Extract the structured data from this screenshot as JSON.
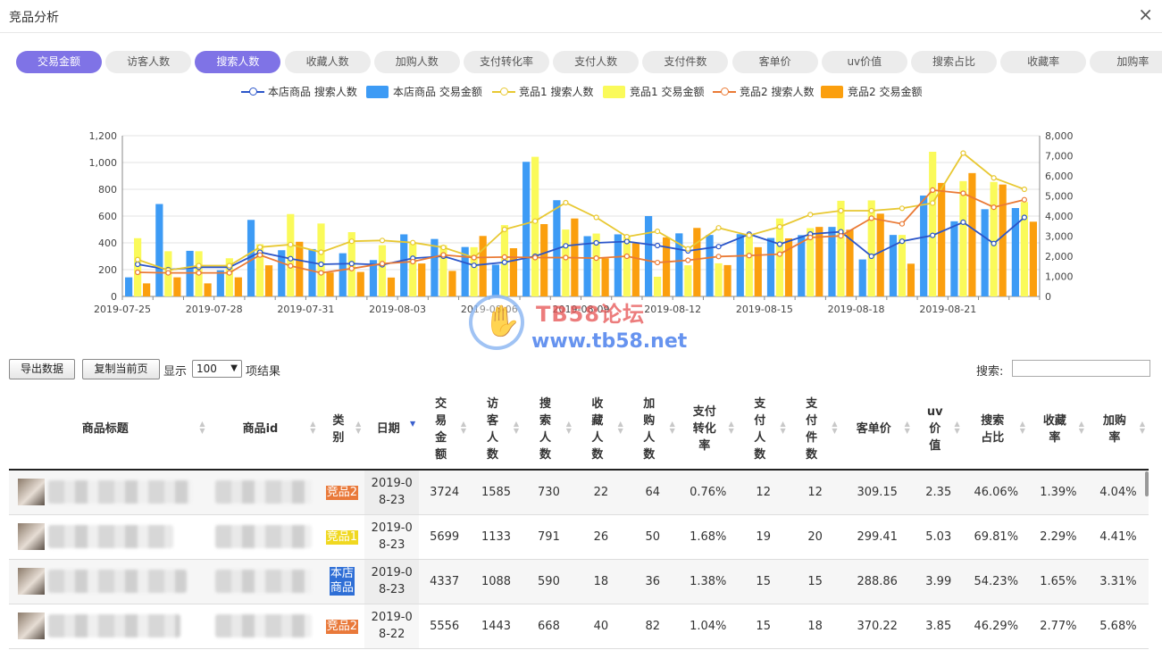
{
  "window": {
    "title": "竞品分析",
    "close_icon": "×"
  },
  "metric_tabs": [
    {
      "label": "交易金额",
      "active": true
    },
    {
      "label": "访客人数",
      "active": false
    },
    {
      "label": "搜索人数",
      "active": true
    },
    {
      "label": "收藏人数",
      "active": false
    },
    {
      "label": "加购人数",
      "active": false
    },
    {
      "label": "支付转化率",
      "active": false
    },
    {
      "label": "支付人数",
      "active": false
    },
    {
      "label": "支付件数",
      "active": false
    },
    {
      "label": "客单价",
      "active": false
    },
    {
      "label": "uv价值",
      "active": false
    },
    {
      "label": "搜索占比",
      "active": false
    },
    {
      "label": "收藏率",
      "active": false
    },
    {
      "label": "加购率",
      "active": false
    }
  ],
  "legend": [
    {
      "label": "本店商品 搜索人数",
      "kind": "line",
      "color": "#2b55c9"
    },
    {
      "label": "本店商品 交易金额",
      "kind": "bar",
      "color": "#3d9bf5"
    },
    {
      "label": "竞品1 搜索人数",
      "kind": "line",
      "color": "#e8c832"
    },
    {
      "label": "竞品1 交易金额",
      "kind": "bar",
      "color": "#fafa5a"
    },
    {
      "label": "竞品2 搜索人数",
      "kind": "line",
      "color": "#ea7a35"
    },
    {
      "label": "竞品2 交易金额",
      "kind": "bar",
      "color": "#fb9f0e"
    }
  ],
  "chart_data": {
    "type": "bar",
    "x": [
      "2019-07-25",
      "2019-07-26",
      "2019-07-27",
      "2019-07-28",
      "2019-07-29",
      "2019-07-30",
      "2019-07-31",
      "2019-08-01",
      "2019-08-02",
      "2019-08-03",
      "2019-08-04",
      "2019-08-05",
      "2019-08-06",
      "2019-08-07",
      "2019-08-08",
      "2019-08-09",
      "2019-08-10",
      "2019-08-11",
      "2019-08-12",
      "2019-08-13",
      "2019-08-14",
      "2019-08-15",
      "2019-08-16",
      "2019-08-17",
      "2019-08-18",
      "2019-08-19",
      "2019-08-20",
      "2019-08-21",
      "2019-08-22",
      "2019-08-23"
    ],
    "x_tick_labels": [
      "2019-07-25",
      "2019-07-28",
      "2019-07-31",
      "2019-08-03",
      "2019-08-06",
      "2019-08-09",
      "2019-08-12",
      "2019-08-15",
      "2019-08-18",
      "2019-08-21"
    ],
    "y_left": {
      "min": 0,
      "max": 1200,
      "ticks": [
        "0",
        "200",
        "400",
        "600",
        "800",
        "1,000",
        "1,200"
      ]
    },
    "y_right": {
      "min": 0,
      "max": 8000,
      "ticks": [
        "0",
        "1,000",
        "2,000",
        "3,000",
        "4,000",
        "5,000",
        "6,000",
        "7,000",
        "8,000"
      ]
    },
    "grid": true,
    "legend_position": "top",
    "bar_series": [
      {
        "name": "本店商品 交易金额",
        "axis": "right",
        "color": "#3d9bf5",
        "values": [
          950,
          4600,
          2270,
          1300,
          3810,
          2300,
          2360,
          2150,
          1810,
          3090,
          2860,
          2460,
          1580,
          6700,
          4790,
          3000,
          3090,
          4000,
          3140,
          3060,
          3100,
          2910,
          3050,
          3460,
          1840,
          3060,
          5020,
          3740,
          4340,
          4400
        ]
      },
      {
        "name": "竞品1 交易金额",
        "axis": "right",
        "color": "#fafa5a",
        "values": [
          2900,
          2250,
          2250,
          1900,
          2600,
          4100,
          3630,
          3200,
          2550,
          2640,
          2550,
          2450,
          3550,
          6950,
          3330,
          3130,
          3000,
          980,
          1550,
          1650,
          3000,
          3880,
          3400,
          4760,
          4780,
          3060,
          7200,
          5740,
          5700,
          4700
        ]
      },
      {
        "name": "竞品2 交易金额",
        "axis": "right",
        "color": "#fb9f0e",
        "values": [
          650,
          950,
          650,
          950,
          1550,
          2720,
          1190,
          1220,
          940,
          1640,
          1270,
          3010,
          2400,
          3600,
          3880,
          1900,
          2650,
          2940,
          3410,
          1560,
          2450,
          2890,
          3460,
          3320,
          4120,
          1630,
          5650,
          6140,
          5570,
          3720
        ]
      }
    ],
    "line_series": [
      {
        "name": "本店商品 搜索人数",
        "axis": "left",
        "color": "#2b55c9",
        "values": [
          240,
          200,
          218,
          218,
          330,
          282,
          240,
          245,
          236,
          285,
          300,
          232,
          255,
          300,
          378,
          400,
          410,
          380,
          340,
          372,
          465,
          390,
          466,
          483,
          300,
          412,
          456,
          554,
          395,
          590
        ]
      },
      {
        "name": "竞品1 搜索人数",
        "axis": "left",
        "color": "#e8c832",
        "values": [
          275,
          195,
          230,
          230,
          368,
          387,
          330,
          412,
          418,
          402,
          366,
          290,
          500,
          562,
          700,
          590,
          446,
          486,
          355,
          512,
          455,
          520,
          611,
          640,
          640,
          658,
          697,
          1070,
          885,
          800
        ]
      },
      {
        "name": "竞品2 搜索人数",
        "axis": "left",
        "color": "#ea7a35",
        "values": [
          180,
          176,
          176,
          176,
          309,
          228,
          176,
          208,
          245,
          260,
          310,
          290,
          294,
          290,
          290,
          286,
          300,
          253,
          270,
          298,
          305,
          316,
          440,
          452,
          584,
          542,
          794,
          770,
          666,
          722
        ]
      }
    ]
  },
  "watermark": {
    "line1": "TB58论坛",
    "line2": "www.tb58.net"
  },
  "toolbar": {
    "export_label": "导出数据",
    "copy_label": "复制当前页",
    "show_label": "显示",
    "page_size": "100",
    "suffix_label": "项结果",
    "search_label": "搜索:"
  },
  "table": {
    "headers": [
      "商品标题",
      "商品id",
      "类别",
      "日期",
      "交易金额",
      "访客人数",
      "搜索人数",
      "收藏人数",
      "加购人数",
      "支付转化率",
      "支付人数",
      "支付件数",
      "客单价",
      "uv价值",
      "搜索占比",
      "收藏率",
      "加购率"
    ],
    "header_display": [
      "商品标题",
      "商品id",
      "类<br>别",
      "日期",
      "交<br>易<br>金<br>额",
      "访<br>客<br>人<br>数",
      "搜<br>索<br>人<br>数",
      "收<br>藏<br>人<br>数",
      "加<br>购<br>人<br>数",
      "支付<br>转化<br>率",
      "支<br>付<br>人<br>数",
      "支<br>付<br>件<br>数",
      "客单价",
      "uv<br>价<br>值",
      "搜索<br>占比",
      "收藏<br>率",
      "加购<br>率"
    ],
    "rows": [
      {
        "category": "竞品2",
        "cat_class": "c2",
        "date": "2019-08-23",
        "cells": [
          "3724",
          "1585",
          "730",
          "22",
          "64",
          "0.76%",
          "12",
          "12",
          "309.15",
          "2.35",
          "46.06%",
          "1.39%",
          "4.04%"
        ]
      },
      {
        "category": "竞品1",
        "cat_class": "c1",
        "date": "2019-08-23",
        "cells": [
          "5699",
          "1133",
          "791",
          "26",
          "50",
          "1.68%",
          "19",
          "20",
          "299.41",
          "5.03",
          "69.81%",
          "2.29%",
          "4.41%"
        ]
      },
      {
        "category": "本店商品",
        "cat_class": "c0",
        "date": "2019-08-23",
        "cells": [
          "4337",
          "1088",
          "590",
          "18",
          "36",
          "1.38%",
          "15",
          "15",
          "288.86",
          "3.99",
          "54.23%",
          "1.65%",
          "3.31%"
        ]
      },
      {
        "category": "竞品2",
        "cat_class": "c2",
        "date": "2019-08-22",
        "cells": [
          "5556",
          "1443",
          "668",
          "40",
          "82",
          "1.04%",
          "15",
          "18",
          "370.22",
          "3.85",
          "46.29%",
          "2.77%",
          "5.68%"
        ]
      }
    ]
  }
}
